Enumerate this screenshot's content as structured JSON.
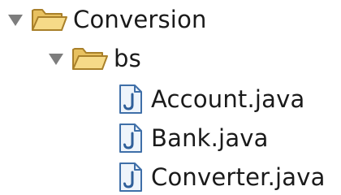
{
  "tree": {
    "project": {
      "label": "Conversion",
      "expanded": true,
      "icon": "folder-open-icon",
      "package": {
        "label": "bs",
        "expanded": true,
        "icon": "folder-open-icon",
        "files": [
          {
            "label": "Account.java",
            "icon": "java-file-icon"
          },
          {
            "label": "Bank.java",
            "icon": "java-file-icon"
          },
          {
            "label": "Converter.java",
            "icon": "java-file-icon"
          }
        ]
      }
    }
  },
  "colors": {
    "twisty": "#7d7d7d",
    "folder_fill": "#f3d37a",
    "folder_stroke": "#a9802a",
    "java_icon_stroke": "#3f6fa8",
    "java_icon_fill": "#eef4fb",
    "text": "#1a1a1a"
  }
}
